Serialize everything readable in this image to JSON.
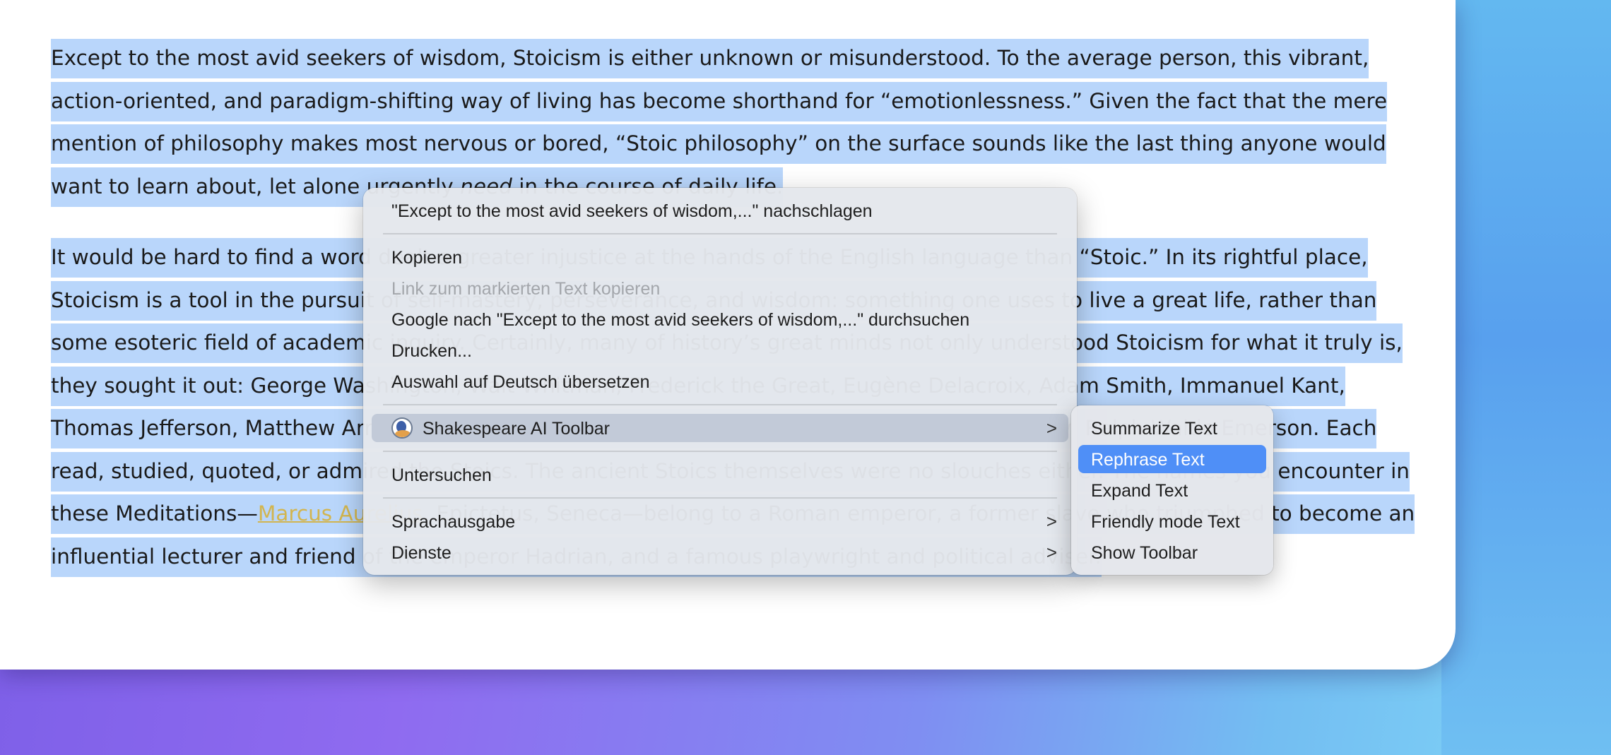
{
  "article": {
    "p1": "Except to the most avid seekers of wisdom, Stoicism is either unknown or misunderstood. To the average person, this vibrant, action-oriented, and paradigm-shifting way of living has become shorthand for “emotionlessness.” Given the fact that the mere mention of philosophy makes most nervous or bored, “Stoic philosophy” on the surface sounds like the last thing anyone would want to learn about, let alone urgently ",
    "p1_em": "need",
    "p1_end": " in the course of daily life.",
    "p2": "It would be hard to find a word dealt a greater injustice at the hands of the English language than “Stoic.” In its rightful place, Stoicism is a tool in the pursuit of self-mastery, perseverance, and wisdom: something one uses to live a great life, rather than some esoteric field of academic inquiry. Certainly, many of history’s great minds not only understood Stoicism for what it truly is, they sought it out: George Washington, Walt Whitman, Frederick the Great, Eugène Delacroix, Adam Smith, Immanuel Kant, Thomas Jefferson, Matthew Arnold, Ambrose Bierce, Theodore Roosevelt, William Alexander Percy, Ralph Waldo Emerson. Each read, studied, quoted, or admired the Stoics. The ancient Stoics themselves were no slouches either. The names you encounter in these Meditations—",
    "p2_link": "Marcus Aurelius",
    "p2_end": ", Epictetus, Seneca—belong to a Roman emperor, a former slave who triumphed to become an influential lecturer and friend of the emperor Hadrian, and a famous playwright and political adviser."
  },
  "context_menu": {
    "lookup": "\"Except to the most avid seekers of wisdom,...\" nachschlagen",
    "copy": "Kopieren",
    "copy_link": "Link zum markierten Text kopieren",
    "google_search": "Google nach \"Except to the most avid seekers of wisdom,...\" durchsuchen",
    "print": "Drucken...",
    "translate": "Auswahl auf Deutsch übersetzen",
    "shakespeare": "Shakespeare AI Toolbar",
    "inspect": "Untersuchen",
    "speech": "Sprachausgabe",
    "services": "Dienste",
    "chevron": ">"
  },
  "submenu": {
    "summarize": "Summarize Text",
    "rephrase": "Rephrase Text",
    "expand": "Expand Text",
    "friendly": "Friendly mode Text",
    "show_toolbar": "Show Toolbar"
  },
  "colors": {
    "selection": "#b9d6fb",
    "highlight": "#4f8ff7",
    "link": "#d2b54f"
  }
}
